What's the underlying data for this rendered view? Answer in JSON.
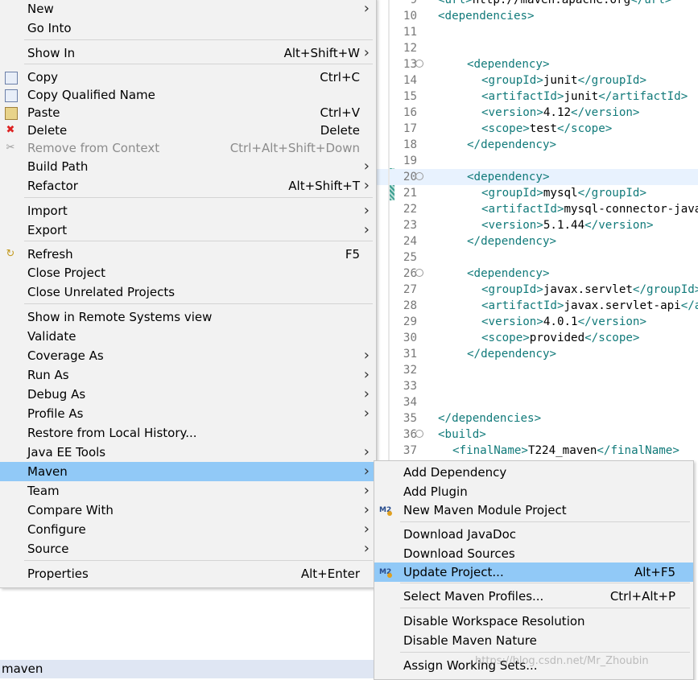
{
  "editor": {
    "lines": [
      {
        "n": "9",
        "code": "<url>http://maven.apache.org</url>"
      },
      {
        "n": "10",
        "code": "<dependencies>"
      },
      {
        "n": "11",
        "code": ""
      },
      {
        "n": "12",
        "code": ""
      },
      {
        "n": "13",
        "code": "<dependency>"
      },
      {
        "n": "14",
        "code": "<groupId>junit</groupId>"
      },
      {
        "n": "15",
        "code": "<artifactId>junit</artifactId>"
      },
      {
        "n": "16",
        "code": "<version>4.12</version>"
      },
      {
        "n": "17",
        "code": "<scope>test</scope>"
      },
      {
        "n": "18",
        "code": "</dependency>"
      },
      {
        "n": "19",
        "code": ""
      },
      {
        "n": "20",
        "code": "<dependency>"
      },
      {
        "n": "21",
        "code": "<groupId>mysql</groupId>"
      },
      {
        "n": "22",
        "code": "<artifactId>mysql-connector-java</artifactId>"
      },
      {
        "n": "23",
        "code": "<version>5.1.44</version>"
      },
      {
        "n": "24",
        "code": "</dependency>"
      },
      {
        "n": "25",
        "code": ""
      },
      {
        "n": "26",
        "code": "<dependency>"
      },
      {
        "n": "27",
        "code": "<groupId>javax.servlet</groupId>"
      },
      {
        "n": "28",
        "code": "<artifactId>javax.servlet-api</artifactId>"
      },
      {
        "n": "29",
        "code": "<version>4.0.1</version>"
      },
      {
        "n": "30",
        "code": "<scope>provided</scope>"
      },
      {
        "n": "31",
        "code": "</dependency>"
      },
      {
        "n": "32",
        "code": ""
      },
      {
        "n": "33",
        "code": ""
      },
      {
        "n": "34",
        "code": ""
      },
      {
        "n": "35",
        "code": "</dependencies>"
      },
      {
        "n": "36",
        "code": "<build>"
      },
      {
        "n": "37",
        "code": "<finalName>T224_maven</finalName>"
      }
    ]
  },
  "bottom_label": "maven",
  "context_menu": {
    "items": [
      {
        "label": "New",
        "shortcut": "",
        "submenu": true
      },
      {
        "label": "Go Into",
        "shortcut": "",
        "submenu": false
      },
      {
        "label": "Show In",
        "shortcut": "Alt+Shift+W",
        "submenu": true
      },
      {
        "label": "Copy",
        "shortcut": "Ctrl+C",
        "icon": "copy-icon"
      },
      {
        "label": "Copy Qualified Name",
        "shortcut": "",
        "icon": "copy-qualified-icon"
      },
      {
        "label": "Paste",
        "shortcut": "Ctrl+V",
        "icon": "paste-icon"
      },
      {
        "label": "Delete",
        "shortcut": "Delete",
        "icon": "delete-icon"
      },
      {
        "label": "Remove from Context",
        "shortcut": "Ctrl+Alt+Shift+Down",
        "icon": "remove-icon",
        "disabled": true
      },
      {
        "label": "Build Path",
        "shortcut": "",
        "submenu": true
      },
      {
        "label": "Refactor",
        "shortcut": "Alt+Shift+T",
        "submenu": true
      },
      {
        "label": "Import",
        "shortcut": "",
        "submenu": true
      },
      {
        "label": "Export",
        "shortcut": "",
        "submenu": true
      },
      {
        "label": "Refresh",
        "shortcut": "F5",
        "icon": "refresh-icon"
      },
      {
        "label": "Close Project",
        "shortcut": ""
      },
      {
        "label": "Close Unrelated Projects",
        "shortcut": ""
      },
      {
        "label": "Show in Remote Systems view",
        "shortcut": ""
      },
      {
        "label": "Validate",
        "shortcut": ""
      },
      {
        "label": "Coverage As",
        "shortcut": "",
        "submenu": true
      },
      {
        "label": "Run As",
        "shortcut": "",
        "submenu": true
      },
      {
        "label": "Debug As",
        "shortcut": "",
        "submenu": true
      },
      {
        "label": "Profile As",
        "shortcut": "",
        "submenu": true
      },
      {
        "label": "Restore from Local History...",
        "shortcut": ""
      },
      {
        "label": "Java EE Tools",
        "shortcut": "",
        "submenu": true
      },
      {
        "label": "Maven",
        "shortcut": "",
        "submenu": true,
        "selected": true
      },
      {
        "label": "Team",
        "shortcut": "",
        "submenu": true
      },
      {
        "label": "Compare With",
        "shortcut": "",
        "submenu": true
      },
      {
        "label": "Configure",
        "shortcut": "",
        "submenu": true
      },
      {
        "label": "Source",
        "shortcut": "",
        "submenu": true
      },
      {
        "label": "Properties",
        "shortcut": "Alt+Enter"
      }
    ]
  },
  "maven_submenu": {
    "items": [
      {
        "label": "Add Dependency",
        "shortcut": ""
      },
      {
        "label": "Add Plugin",
        "shortcut": ""
      },
      {
        "label": "New Maven Module Project",
        "shortcut": "",
        "icon": "maven-module-icon"
      },
      {
        "label": "Download JavaDoc",
        "shortcut": ""
      },
      {
        "label": "Download Sources",
        "shortcut": ""
      },
      {
        "label": "Update Project...",
        "shortcut": "Alt+F5",
        "icon": "maven-update-icon",
        "selected": true
      },
      {
        "label": "Select Maven Profiles...",
        "shortcut": "Ctrl+Alt+P"
      },
      {
        "label": "Disable Workspace Resolution",
        "shortcut": ""
      },
      {
        "label": "Disable Maven Nature",
        "shortcut": ""
      },
      {
        "label": "Assign Working Sets...",
        "shortcut": ""
      }
    ]
  },
  "watermark": "https://blog.csdn.net/Mr_Zhoubin",
  "colors": {
    "selection": "#91c9f7",
    "menu_bg": "#f2f2f2",
    "xml_tag": "#117a7a",
    "line_highlight": "#e8f2fe"
  }
}
